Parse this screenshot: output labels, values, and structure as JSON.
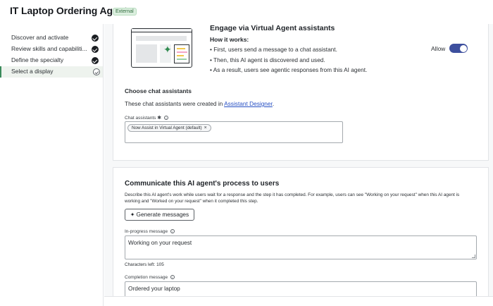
{
  "header": {
    "title": "IT Laptop Ordering Agent",
    "badge": "External"
  },
  "sidebar": {
    "steps": [
      {
        "label": "Discover and activate",
        "status": "complete"
      },
      {
        "label": "Review skills and capabiliti...",
        "status": "complete"
      },
      {
        "label": "Define the specialty",
        "status": "complete"
      },
      {
        "label": "Select a display",
        "status": "current"
      }
    ]
  },
  "engage": {
    "title": "Engage via Virtual Agent assistants",
    "how_title": "How it works:",
    "bullets": [
      "• First, users send a message to a chat assistant.",
      "• Then, this AI agent is discovered and used.",
      "• As a result, users see agentic responses from this AI agent."
    ],
    "allow_label": "Allow",
    "allow_on": true,
    "choose_title": "Choose chat assistants",
    "choose_desc_prefix": "These chat assistants were created in ",
    "choose_desc_link": "Assistant Designer",
    "choose_desc_suffix": ".",
    "chat_label": "Chat assistants",
    "required_mark": "✱",
    "info_glyph": "i",
    "chip": "Now Assist in Virtual Agent (default)",
    "chip_remove": "×"
  },
  "communicate": {
    "title": "Communicate this AI agent's process to users",
    "desc": "Describe this AI agent's work while users wait for a response and the step it has completed. For example, users can see \"Working on your request\" when this AI agent is working and \"Worked on your request\" when it completed this step.",
    "generate_icon": "✦",
    "generate_label": "Generate messages",
    "in_progress_label": "In-progress message",
    "in_progress_value": "Working on your request",
    "chars_left": "Characters left: 105",
    "completion_label": "Completion message",
    "completion_value": "Ordered your laptop"
  },
  "colors": {
    "accent": "#3d4f9e",
    "link": "#2750c4",
    "active_step_bg": "#eef3ee",
    "active_step_border": "#3a8a5b"
  }
}
